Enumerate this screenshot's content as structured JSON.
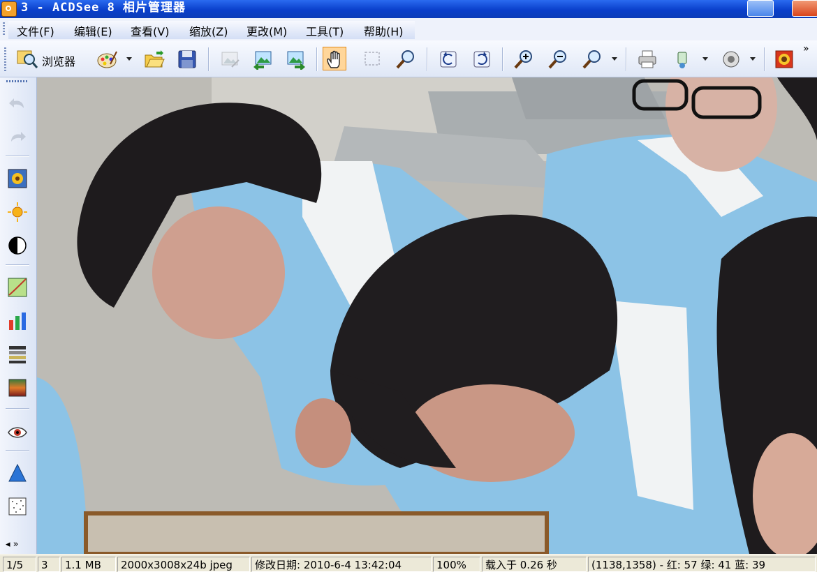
{
  "window": {
    "title": "3 - ACDSee 8 相片管理器"
  },
  "menu": [
    {
      "label": "文件(F)"
    },
    {
      "label": "编辑(E)"
    },
    {
      "label": "查看(V)"
    },
    {
      "label": "缩放(Z)"
    },
    {
      "label": "更改(M)"
    },
    {
      "label": "工具(T)"
    },
    {
      "label": "帮助(H)"
    }
  ],
  "toolbar": {
    "browser_label": "浏览器",
    "overflow_label": "»"
  },
  "sidebar": {
    "scroll_label": "◂ »"
  },
  "status": {
    "index": "1/5",
    "name": "3",
    "size": "1.1 MB",
    "dimensions": "2000x3008x24b jpeg",
    "modified": "修改日期: 2010-6-4 13:42:04",
    "zoom": "100%",
    "load_time": "载入于 0.26 秒",
    "pixel": "(1138,1358) - 红: 57 绿: 41 蓝: 39"
  },
  "colors": {
    "title_bar": "#0A3FCB",
    "active_tool": "#FFD69A",
    "uniform": "#8CC3E6"
  }
}
